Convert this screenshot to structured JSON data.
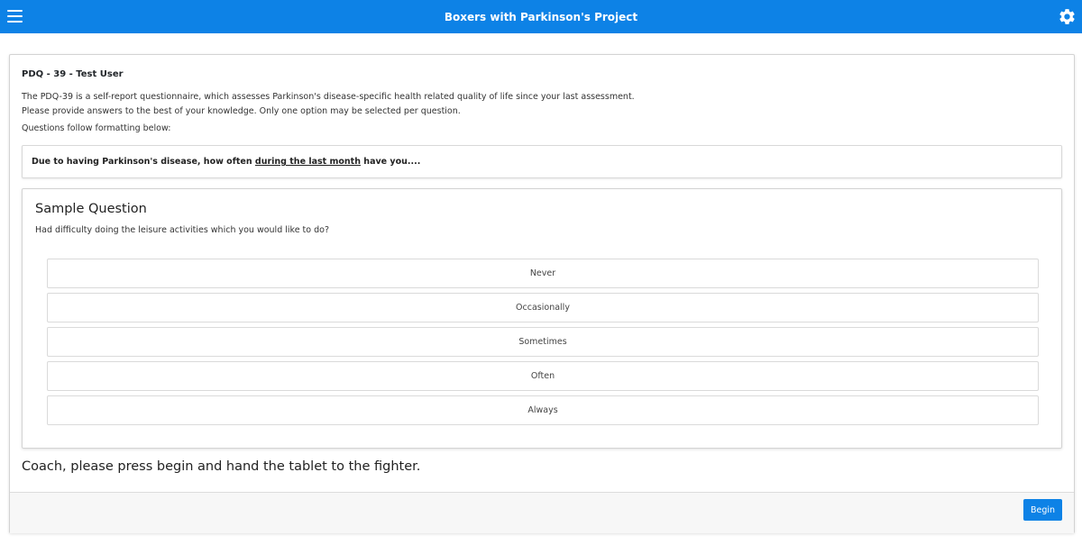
{
  "header": {
    "title": "Boxers with Parkinson's Project",
    "menu_icon": "hamburger-menu-icon",
    "settings_icon": "gear-icon",
    "bg_color": "#0d82e6"
  },
  "card": {
    "title": "PDQ - 39 - Test User",
    "intro_line1": "The PDQ-39 is a self-report questionnaire, which assesses Parkinson's disease-specific health related quality of life since your last assessment.",
    "intro_line2": "Please provide answers to the best of your knowledge. Only one option may be selected per question.",
    "format_note": "Questions follow formatting below:",
    "stem": {
      "before": "Due to having Parkinson's disease, how often ",
      "underlined": "during the last month",
      "after": " have you...."
    },
    "sample": {
      "title": "Sample Question",
      "question": "Had difficulty doing the leisure activities which you would like to do?",
      "options": [
        "Never",
        "Occasionally",
        "Sometimes",
        "Often",
        "Always"
      ]
    },
    "coach_message": "Coach, please press begin and hand the tablet to the fighter.",
    "begin_label": "Begin"
  }
}
